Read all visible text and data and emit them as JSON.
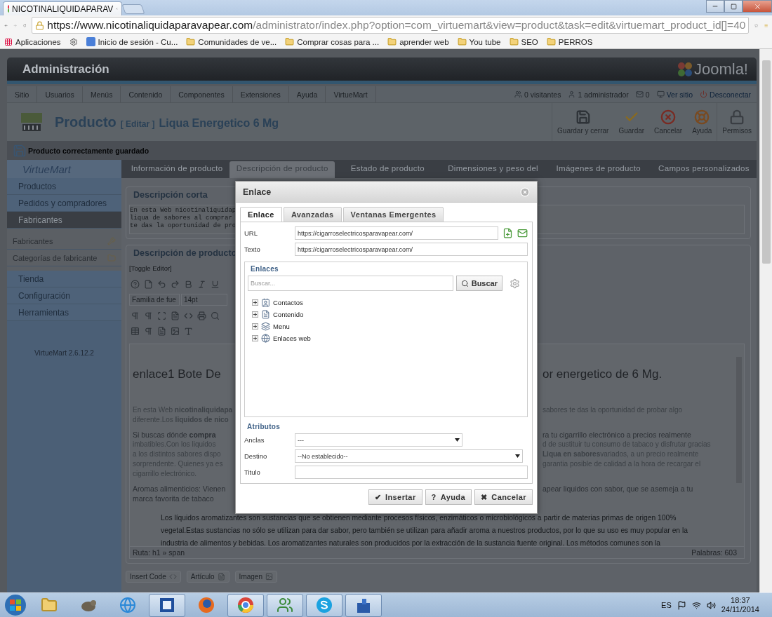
{
  "browser": {
    "tab_title": "NICOTINALIQUIDAPARAV",
    "url_host": "https://www.nicotinaliquidaparavapear.com",
    "url_path": "/administrator/index.php?option=com_virtuemart&view=product&task=edit&virtuemart_product_id[]=40",
    "bookmarks": [
      {
        "kind": "apps",
        "label": "Aplicaciones"
      },
      {
        "kind": "settings"
      },
      {
        "kind": "google",
        "label": "Inicio de sesión - Cu..."
      },
      {
        "kind": "folder",
        "label": "Comunidades de ve..."
      },
      {
        "kind": "folder",
        "label": "Comprar cosas para ..."
      },
      {
        "kind": "folder",
        "label": "aprender web"
      },
      {
        "kind": "folder",
        "label": "You tube"
      },
      {
        "kind": "folder",
        "label": "SEO"
      },
      {
        "kind": "folder",
        "label": "PERROS"
      }
    ]
  },
  "header": {
    "title": "Administración",
    "logo_text": "Joomla!"
  },
  "nav": {
    "items": [
      "Sitio",
      "Usuarios",
      "Menús",
      "Contenido",
      "Componentes",
      "Extensiones",
      "Ayuda",
      "VirtueMart"
    ],
    "status": [
      {
        "kind": "visitors",
        "label": "0 visitantes"
      },
      {
        "kind": "admins",
        "label": "1 administrador"
      },
      {
        "kind": "messages",
        "label": "0"
      },
      {
        "kind": "site",
        "label": "Ver sitio"
      },
      {
        "kind": "logout",
        "label": "Desconectar"
      }
    ]
  },
  "toolbar": {
    "title": "Producto",
    "action": "[ Editar ]",
    "product": "Liqua Energetico 6 Mg",
    "buttons": [
      {
        "kind": "save-close",
        "label": "Guardar y cerrar"
      },
      {
        "kind": "save",
        "label": "Guardar"
      },
      {
        "kind": "cancel",
        "label": "Cancelar"
      },
      {
        "kind": "help",
        "label": "Ayuda"
      },
      {
        "kind": "permissions",
        "label": "Permisos"
      }
    ]
  },
  "message": "Producto correctamente guardado",
  "sidebar": {
    "logo_text": "VirtueMart",
    "items": [
      {
        "label": "Productos",
        "selected": false
      },
      {
        "label": "Pedidos y compradores",
        "selected": false
      },
      {
        "label": "Fabricantes",
        "selected": true,
        "expanded": true,
        "children": [
          {
            "kind": "tools",
            "label": "Fabricantes"
          },
          {
            "kind": "folder",
            "label": "Categorías de fabricante"
          }
        ]
      },
      {
        "label": "Tienda",
        "selected": false
      },
      {
        "label": "Configuración",
        "selected": false
      },
      {
        "label": "Herramientas",
        "selected": false
      }
    ],
    "version": "VirtueMart 2.6.12.2"
  },
  "tabs": [
    {
      "label": "Información de producto",
      "selected": false
    },
    {
      "label": "Descripción de producto",
      "selected": true
    },
    {
      "label": "Estado de producto",
      "selected": false
    },
    {
      "label": "Dimensiones y peso del",
      "selected": false
    },
    {
      "label": "Imágenes de producto",
      "selected": false
    },
    {
      "label": "Campos personalizados",
      "selected": false
    }
  ],
  "short_description": {
    "title": "Descripción corta",
    "lines": [
      "En esta Web nicotinaliquidap",
      "liqua de sabores al comprar",
      "te das la oportunidad de pro"
    ]
  },
  "description": {
    "title": "Descripción de producto",
    "toggle": "[Toggle Editor]",
    "font_family": "Familia de fue",
    "font_size": "14pt",
    "heading": {
      "left": "enlace1 Bote De",
      "right": "or energetico de 6 Mg."
    },
    "paragraphs": [
      {
        "lines": [
          {
            "kind": "small",
            "left": "En esta Web **nicotinaliquidapa**",
            "right": "sabores te das la oportunidad de probar algo"
          },
          {
            "kind": "small",
            "left": "diferente.Los **liquidos de nico**"
          }
        ]
      },
      {
        "lines": [
          {
            "kind": "lead",
            "left": "Si buscas dónde **compra**",
            "right": "ra tu cigarrillo electrónico a precios realmente"
          },
          {
            "kind": "small",
            "left": "imbatibles.Con los liquidos",
            "right": "d de sustituir tu consumo de tabaco y disfrutar gracias"
          },
          {
            "kind": "small",
            "left": "a los distintos sabores dispo",
            "right": "**Liqua en sabores**variados, a un precio realmente"
          },
          {
            "kind": "small",
            "left": "sorprendente. Quienes ya es",
            "right": "garantia posible de calidad  a la hora de recargar el"
          },
          {
            "kind": "small",
            "left": "cigarrillo electrónico."
          }
        ]
      },
      {
        "lines": [
          {
            "kind": "lead",
            "left": "Aromas alimenticios: Vienen",
            "right": "apear liquidos con sabor, que se asemeja a tu"
          },
          {
            "kind": "lead",
            "left": "marca favorita de   tabaco"
          }
        ]
      }
    ],
    "full_lines": [
      "Los líquidos aromatizantes son sustancias que se obtienen mediante procesos físicos, enzimáticos o microbiológicos a partir de materias primas de origen 100%",
      "vegetal.Estas sustancias no sólo se utilizan para dar sabor, pero también se utilizan para añadir aroma a nuestros productos, por lo que su uso es muy popular en la",
      "industria de alimentos y bebidas. Los aromatizantes naturales son producidos por la extracción de la sustancia fuente original. Los métodos comunes son la"
    ],
    "path": "Ruta:  h1 » span",
    "word_count": "Palabras: 603",
    "buttons": [
      {
        "kind": "code",
        "label": "Insert Code"
      },
      {
        "kind": "article",
        "label": "Artículo"
      },
      {
        "kind": "image",
        "label": "Imagen"
      }
    ]
  },
  "dialog": {
    "title": "Enlace",
    "tabs": [
      {
        "label": "Enlace",
        "selected": true
      },
      {
        "label": "Avanzadas",
        "selected": false
      },
      {
        "label": "Ventanas Emergentes",
        "selected": false
      }
    ],
    "url_label": "URL",
    "url": "https://cigarroselectricosparavapear.com/",
    "text_label": "Texto",
    "text": "https://cigarroselectricosparavapear.com/",
    "links_legend": "Enlaces",
    "search_placeholder": "Buscar...",
    "search_button": "Buscar",
    "tree": [
      {
        "kind": "contacts",
        "label": "Contactos",
        "expanded": false
      },
      {
        "kind": "content",
        "label": "Contenido",
        "expanded": false
      },
      {
        "kind": "menu",
        "label": "Menu",
        "expanded": false
      },
      {
        "kind": "weblinks",
        "label": "Enlaces web",
        "expanded": false
      }
    ],
    "attributes_legend": "Atributos",
    "anchors_label": "Anclas",
    "anchors_value": "---",
    "target_label": "Destino",
    "target_value": "--No establecido--",
    "title_label": "Titulo",
    "buttons": [
      {
        "icon": "✔",
        "label": "Insertar"
      },
      {
        "icon": "?",
        "label": "Ayuda"
      },
      {
        "icon": "✖",
        "label": "Cancelar"
      }
    ]
  },
  "taskbar": {
    "items": [
      {
        "kind": "explorer",
        "running": false
      },
      {
        "kind": "gimp",
        "running": false
      },
      {
        "kind": "ie",
        "running": false
      },
      {
        "kind": "word",
        "running": true
      },
      {
        "kind": "firefox",
        "running": false
      },
      {
        "kind": "chrome",
        "running": true
      },
      {
        "kind": "people",
        "running": true
      },
      {
        "kind": "skype",
        "running": true
      },
      {
        "kind": "castle",
        "running": true
      }
    ],
    "language": "ES",
    "time": "18:37",
    "date": "24/11/2014"
  }
}
